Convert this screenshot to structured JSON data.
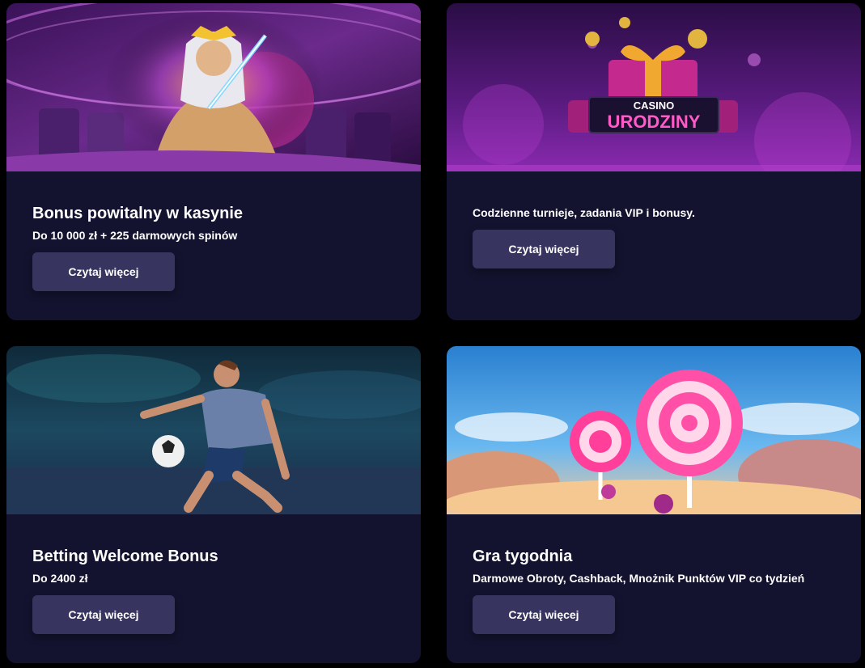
{
  "cards": [
    {
      "title": "Bonus powitalny w kasynie",
      "subtitle": "Do 10 000 zł + 225 darmowych spinów",
      "button_label": "Czytaj więcej",
      "banner_icon": "zeus-slot-banner"
    },
    {
      "title": "",
      "subtitle": "Codzienne turnieje, zadania VIP i bonusy.",
      "button_label": "Czytaj więcej",
      "banner_icon": "birthday-gift-banner",
      "banner_brand": "CASINO",
      "banner_text": "URODZINY"
    },
    {
      "title": "Betting Welcome Bonus",
      "subtitle": "Do 2400 zł",
      "button_label": "Czytaj więcej",
      "banner_icon": "football-player-banner"
    },
    {
      "title": "Gra tygodnia",
      "subtitle": "Darmowe Obroty, Cashback, Mnożnik Punktów VIP co tydzień",
      "button_label": "Czytaj więcej",
      "banner_icon": "candy-lollipop-banner"
    }
  ],
  "colors": {
    "page_background": "#000000",
    "card_background": "#14132f",
    "button_background": "#37355f",
    "text": "#ffffff"
  }
}
